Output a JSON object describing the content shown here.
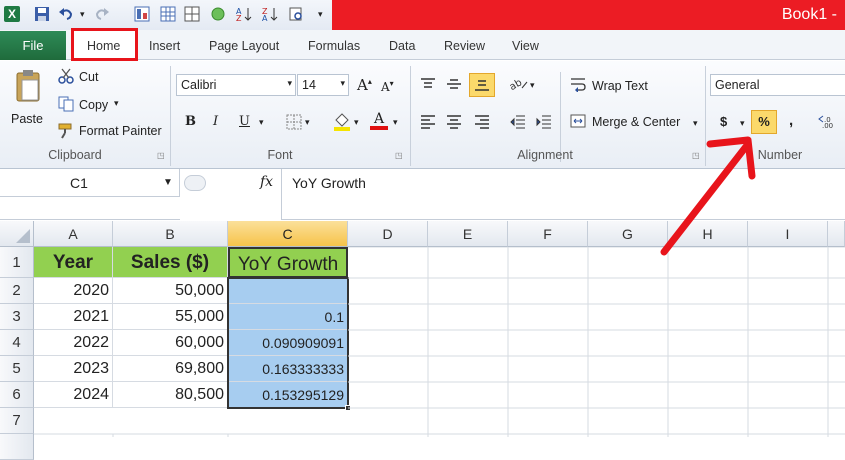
{
  "title": "Book1 -",
  "tabs": [
    "File",
    "Home",
    "Insert",
    "Page Layout",
    "Formulas",
    "Data",
    "Review",
    "View"
  ],
  "clipboard": {
    "paste": "Paste",
    "cut": "Cut",
    "copy": "Copy",
    "format_painter": "Format Painter",
    "group": "Clipboard"
  },
  "font": {
    "name": "Calibri",
    "size": "14",
    "bold": "B",
    "italic": "I",
    "underline": "U",
    "font_color": "A",
    "group": "Font"
  },
  "alignment": {
    "wrap": "Wrap Text",
    "merge": "Merge & Center",
    "group": "Alignment"
  },
  "number": {
    "format": "General",
    "currency": "$",
    "percent": "%",
    "comma": ",",
    "group": "Number"
  },
  "name_box": "C1",
  "fx": "fx",
  "formula": "YoY Growth",
  "columns": [
    "A",
    "B",
    "C",
    "D",
    "E",
    "F",
    "G",
    "H",
    "I"
  ],
  "rows": [
    "1",
    "2",
    "3",
    "4",
    "5",
    "6",
    "7"
  ],
  "cells": {
    "a1": "Year",
    "b1": "Sales ($)",
    "c1": "YoY Growth",
    "a2": "2020",
    "b2": "50,000",
    "c2": "",
    "a3": "2021",
    "b3": "55,000",
    "c3": "0.1",
    "a4": "2022",
    "b4": "60,000",
    "c4": "0.090909091",
    "a5": "2023",
    "b5": "69,800",
    "c5": "0.163333333",
    "a6": "2024",
    "b6": "80,500",
    "c6": "0.153295129"
  },
  "colors": {
    "title_bar": "#ec1c24",
    "file_tab": "#217346",
    "header_fill": "#92d050",
    "selection": "#a7cdf0",
    "annotation": "#e8141b"
  }
}
